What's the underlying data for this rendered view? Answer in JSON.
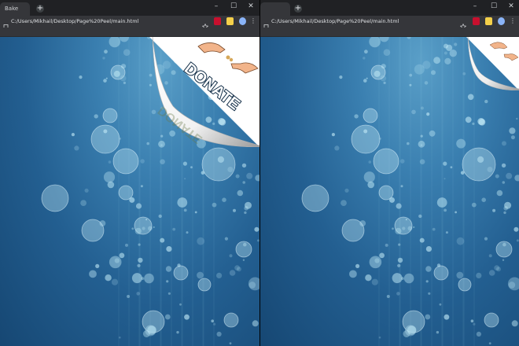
{
  "windows": [
    {
      "tab_title": "Bake",
      "new_tab_symbol": "+",
      "address": "C:/Users/Mikhail/Desktop/Page%20Peel/main.html",
      "controls": {
        "minimize": "–",
        "maximize": "☐",
        "close": "✕"
      },
      "peel": {
        "state": "expanded",
        "ad_text": "DONATE"
      }
    },
    {
      "tab_title": "",
      "new_tab_symbol": "+",
      "address": "C:/Users/Mikhail/Desktop/Page%20Peel/main.html",
      "controls": {
        "minimize": "–",
        "maximize": "☐",
        "close": "✕"
      },
      "peel": {
        "state": "collapsed"
      }
    }
  ],
  "colors": {
    "background_top": "#5a9fc8",
    "background_bottom": "#164773",
    "bubble": "#bfe8f5",
    "donate_fill": "#ffffff",
    "donate_stroke": "#0e2a44"
  }
}
